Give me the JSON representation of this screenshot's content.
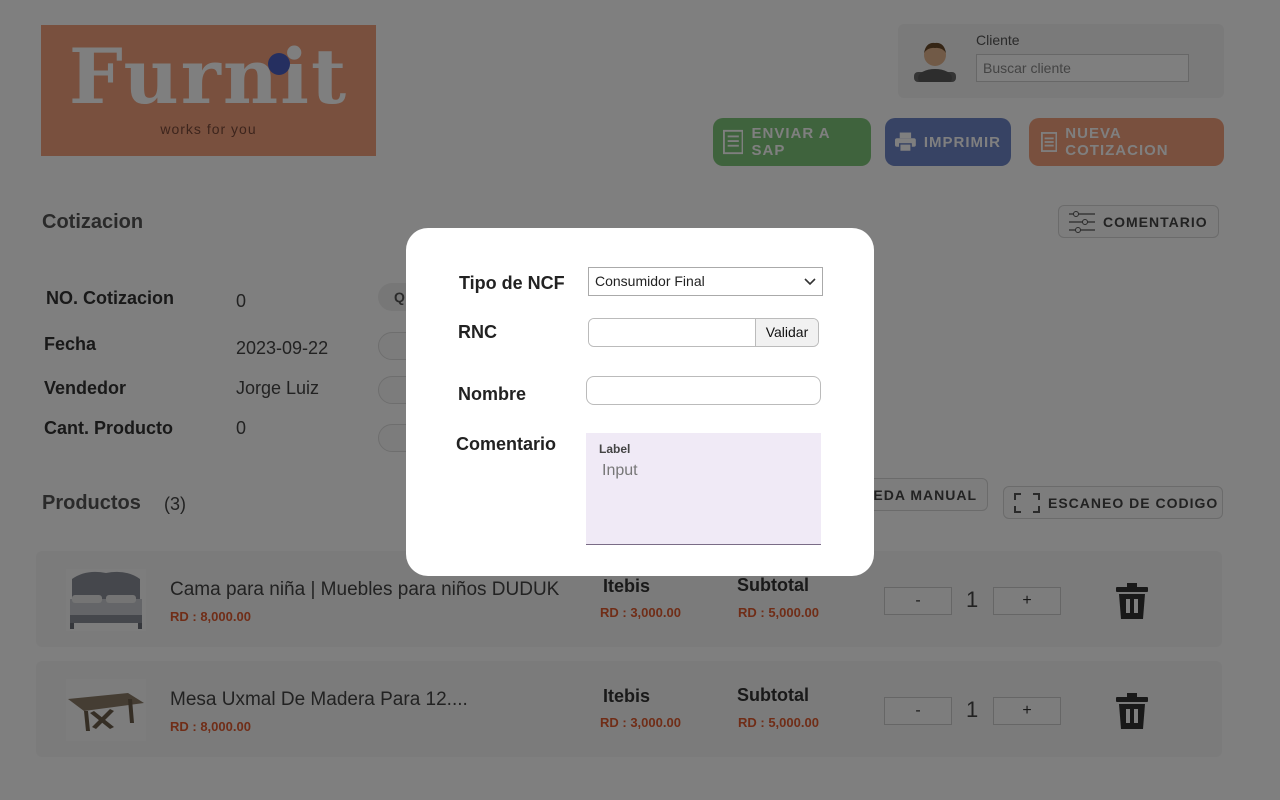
{
  "brand": {
    "word": "Furnit",
    "tagline": "works for you"
  },
  "client": {
    "label": "Cliente",
    "placeholder": "Buscar cliente"
  },
  "actions": {
    "send_sap": "ENVIAR A SAP",
    "print": "IMPRIMIR",
    "new_quote": "NUEVA COTIZACION"
  },
  "quote": {
    "title": "Cotizacion",
    "comment_button": "COMENTARIO",
    "fields": [
      {
        "label": "NO. Cotizacion",
        "value": "0"
      },
      {
        "label": "Fecha",
        "value": "2023-09-22"
      },
      {
        "label": "Vendedor",
        "value": "Jorge Luiz"
      },
      {
        "label": "Cant. Producto",
        "value": "0"
      }
    ],
    "partial_button": "Q"
  },
  "products": {
    "title": "Productos",
    "count": "(3)",
    "manual_search": "EDA MANUAL",
    "scan_code": "ESCANEO DE CODIGO",
    "itebis_label": "Itebis",
    "subtotal_label": "Subtotal",
    "minus": "-",
    "plus": "+",
    "items": [
      {
        "name": "Cama para niña | Muebles para niños DUDUK",
        "price": "RD : 8,000.00",
        "itebis": "RD : 3,000.00",
        "subtotal": "RD : 5,000.00",
        "qty": "1"
      },
      {
        "name": "Mesa Uxmal De Madera Para 12....",
        "price": "RD : 8,000.00",
        "itebis": "RD : 3,000.00",
        "subtotal": "RD : 5,000.00",
        "qty": "1"
      }
    ]
  },
  "modal": {
    "ncf_label": "Tipo de NCF",
    "ncf_value": "Consumidor Final",
    "rnc_label": "RNC",
    "rnc_value": "",
    "validar": "Validar",
    "nombre_label": "Nombre",
    "nombre_value": "",
    "comentario_label": "Comentario",
    "textarea_label": "Label",
    "textarea_placeholder": "Input"
  },
  "colors": {
    "brand_orange": "#f3a07c",
    "sap_green": "#7fc77a",
    "print_blue": "#6f86c8",
    "price_red": "#e05b2f",
    "overlay": "rgba(0,0,0,0.5)"
  }
}
